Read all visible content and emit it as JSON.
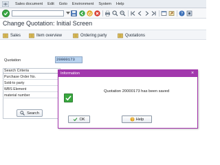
{
  "menubar": {
    "items": [
      "Sales document",
      "Edit",
      "Goto",
      "Environment",
      "System",
      "Help"
    ]
  },
  "toolbar": {
    "icons": [
      "enter-icon",
      "save-icon",
      "back-icon",
      "exit-icon",
      "cancel-icon",
      "print-icon",
      "find-icon",
      "find-next-icon",
      "first-page-icon",
      "previous-page-icon",
      "next-page-icon",
      "last-page-icon",
      "create-session-icon",
      "shortcut-icon",
      "help-icon",
      "settings-icon"
    ]
  },
  "page": {
    "title": "Change Quotation: Initial Screen"
  },
  "app_toolbar": {
    "sales": "Sales",
    "item_overview": "Item overview",
    "ordering_party": "Ordering party",
    "quotations": "Quotations"
  },
  "quotation_field": {
    "label": "Quotation",
    "value": "20000173"
  },
  "search_criteria": {
    "title": "Search Criteria",
    "rows": [
      "Purchase Order No.",
      "Sold-to party",
      "WBS Element",
      "material number"
    ],
    "search_button": "Search"
  },
  "dialog": {
    "title": "Information",
    "message": "Quotation 20000173 has been saved",
    "ok_button": "OK",
    "help_button": "Help"
  },
  "colors": {
    "dialog_header": "#a238ad",
    "selected_field": "#b9d3ef",
    "success_green": "#39a83f"
  }
}
